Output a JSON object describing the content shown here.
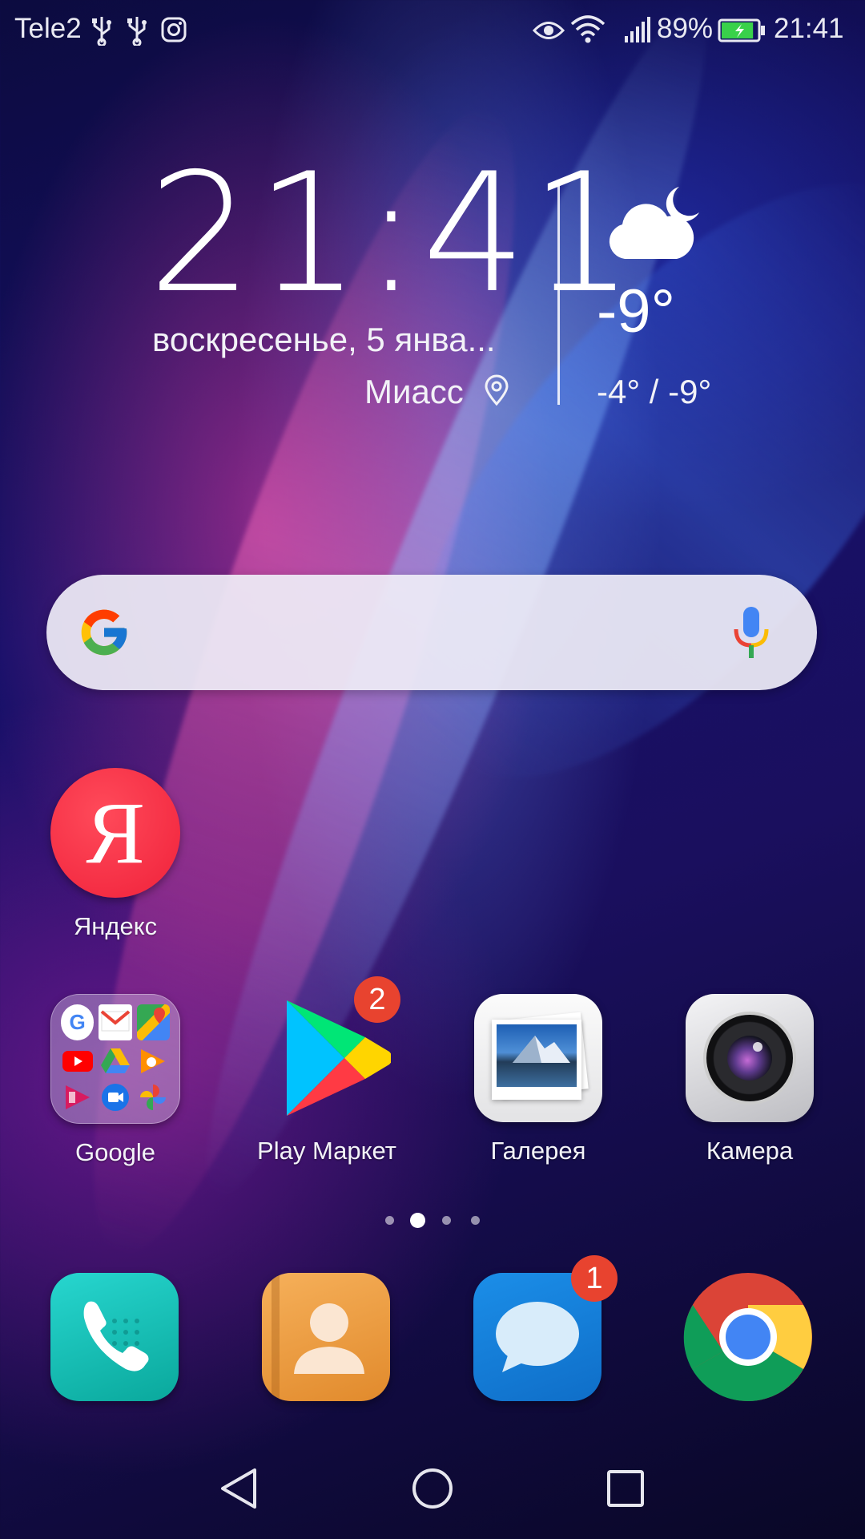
{
  "status_bar": {
    "carrier": "Tele2",
    "battery_percent": "89%",
    "time": "21:41",
    "battery_level": 0.89,
    "left_icons": [
      "usb-icon",
      "usb-icon",
      "instagram-icon"
    ],
    "right_icons": [
      "eye-icon",
      "wifi-icon",
      "signal-icon",
      "battery-charging-icon"
    ]
  },
  "clock_widget": {
    "time": "21:41",
    "date": "воскресенье, 5 янва...",
    "city": "Миасс"
  },
  "weather_widget": {
    "icon": "cloud-moon-icon",
    "temperature": "-9°",
    "range": "-4° / -9°"
  },
  "search_bar": {
    "logo": "google-g-icon",
    "mic": "mic-icon"
  },
  "apps": {
    "yandex": {
      "label": "Яндекс",
      "glyph": "Я"
    },
    "google_folder": {
      "label": "Google",
      "contents": [
        "google-icon",
        "gmail-icon",
        "maps-icon",
        "youtube-icon",
        "drive-icon",
        "play-music-icon",
        "play-movies-icon",
        "duo-icon",
        "photos-icon"
      ]
    },
    "play_market": {
      "label": "Play Маркет",
      "badge": "2"
    },
    "gallery": {
      "label": "Галерея"
    },
    "camera": {
      "label": "Камера"
    }
  },
  "page_indicator": {
    "pages": 4,
    "current": 2
  },
  "dock": {
    "phone": {
      "icon": "phone-icon"
    },
    "contacts": {
      "icon": "contacts-icon"
    },
    "messages": {
      "icon": "messages-icon",
      "badge": "1"
    },
    "chrome": {
      "icon": "chrome-icon"
    }
  },
  "nav_bar": {
    "back": "back-icon",
    "home": "home-icon",
    "recents": "recents-icon"
  }
}
